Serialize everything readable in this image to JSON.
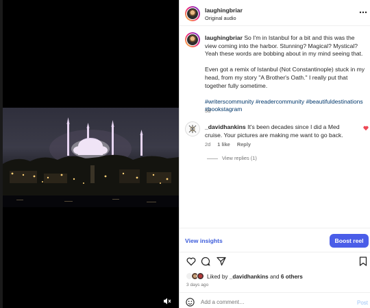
{
  "post": {
    "username": "laughingbriar",
    "audio": "Original audio",
    "caption_username": "laughingbriar",
    "caption_text": "So I'm in Istanbul for a bit and this was the view coming into the harbor. Stunning? Magical? Mystical? Yeah these words are bobbing about in my mind seeing that.",
    "caption_para2": "Even got a remix of Istanbul (Not Constantinople) stuck in my head, from my story \"A Brother's Oath.\" I really put that together fully sometime.",
    "hashtags": "#writerscommunity #readercommunity #beautifuldestinations #bookstagram",
    "age": "3d"
  },
  "comment": {
    "username": "_davidhankins",
    "text": "It's been decades since I did a Med cruise. Your pictures are making me want to go back.",
    "age": "2d",
    "likes": "1 like",
    "reply": "Reply",
    "view_replies": "View replies (1)"
  },
  "actions": {
    "insights": "View insights",
    "boost": "Boost reel"
  },
  "likes": {
    "prefix": "Liked by",
    "user": "_davidhankins",
    "and": "and",
    "others": "6 others",
    "time": "3 days ago"
  },
  "composer": {
    "placeholder": "Add a comment…",
    "post": "Post"
  },
  "icons": [
    "more-icon",
    "heart-icon",
    "like-icon",
    "comment-icon",
    "share-icon",
    "bookmark-icon",
    "emoji-icon",
    "mute-icon"
  ],
  "colors": {
    "link": "#00376b",
    "accent": "#4a5de8",
    "heart": "#ed4956"
  }
}
